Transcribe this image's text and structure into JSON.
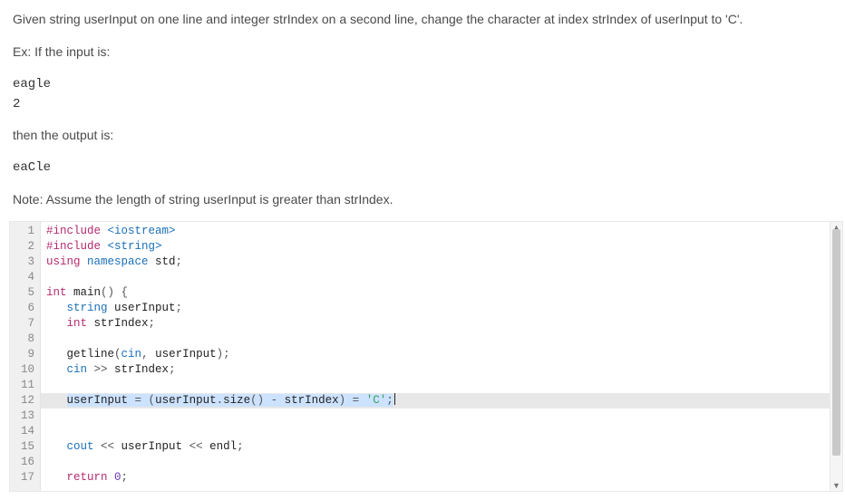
{
  "problem": {
    "statement": "Given string userInput on one line and integer strIndex on a second line, change the character at index strIndex of userInput to 'C'.",
    "example_intro": "Ex: If the input is:",
    "example_input": "eagle\n2",
    "output_intro": "then the output is:",
    "example_output": "eaCle",
    "note": "Note: Assume the length of string userInput is greater than strIndex."
  },
  "code": {
    "lines": [
      {
        "n": 1,
        "tokens": [
          {
            "t": "#include ",
            "c": "kw"
          },
          {
            "t": "<iostream>",
            "c": "type"
          }
        ]
      },
      {
        "n": 2,
        "tokens": [
          {
            "t": "#include ",
            "c": "kw"
          },
          {
            "t": "<string>",
            "c": "type"
          }
        ]
      },
      {
        "n": 3,
        "tokens": [
          {
            "t": "using ",
            "c": "kw"
          },
          {
            "t": "namespace ",
            "c": "type"
          },
          {
            "t": "std",
            "c": "ident"
          },
          {
            "t": ";",
            "c": "punct"
          }
        ]
      },
      {
        "n": 4,
        "tokens": []
      },
      {
        "n": 5,
        "tokens": [
          {
            "t": "int ",
            "c": "kw"
          },
          {
            "t": "main",
            "c": "ident"
          },
          {
            "t": "() {",
            "c": "punct"
          }
        ]
      },
      {
        "n": 6,
        "tokens": [
          {
            "t": "   ",
            "c": "ident"
          },
          {
            "t": "string ",
            "c": "type"
          },
          {
            "t": "userInput",
            "c": "ident"
          },
          {
            "t": ";",
            "c": "punct"
          }
        ]
      },
      {
        "n": 7,
        "tokens": [
          {
            "t": "   ",
            "c": "ident"
          },
          {
            "t": "int ",
            "c": "kw"
          },
          {
            "t": "strIndex",
            "c": "ident"
          },
          {
            "t": ";",
            "c": "punct"
          }
        ]
      },
      {
        "n": 8,
        "tokens": []
      },
      {
        "n": 9,
        "tokens": [
          {
            "t": "   ",
            "c": "ident"
          },
          {
            "t": "getline",
            "c": "ident"
          },
          {
            "t": "(",
            "c": "punct"
          },
          {
            "t": "cin",
            "c": "type"
          },
          {
            "t": ", ",
            "c": "punct"
          },
          {
            "t": "userInput",
            "c": "ident"
          },
          {
            "t": ");",
            "c": "punct"
          }
        ]
      },
      {
        "n": 10,
        "tokens": [
          {
            "t": "   ",
            "c": "ident"
          },
          {
            "t": "cin ",
            "c": "type"
          },
          {
            "t": ">> ",
            "c": "punct"
          },
          {
            "t": "strIndex",
            "c": "ident"
          },
          {
            "t": ";",
            "c": "punct"
          }
        ]
      },
      {
        "n": 11,
        "tokens": []
      },
      {
        "n": 12,
        "highlight": true,
        "selected": true,
        "tokens": [
          {
            "t": "   ",
            "c": "ident"
          },
          {
            "t": "userInput ",
            "c": "ident"
          },
          {
            "t": "= ",
            "c": "punct"
          },
          {
            "t": "(",
            "c": "punct"
          },
          {
            "t": "userInput",
            "c": "ident"
          },
          {
            "t": ".",
            "c": "punct"
          },
          {
            "t": "size",
            "c": "ident"
          },
          {
            "t": "() ",
            "c": "punct"
          },
          {
            "t": "- ",
            "c": "punct"
          },
          {
            "t": "strIndex",
            "c": "ident"
          },
          {
            "t": ") ",
            "c": "punct"
          },
          {
            "t": "= ",
            "c": "punct"
          },
          {
            "t": "'C'",
            "c": "str"
          },
          {
            "t": ";",
            "c": "punct"
          }
        ],
        "cursor_after": true
      },
      {
        "n": 13,
        "tokens": []
      },
      {
        "n": 14,
        "tokens": []
      },
      {
        "n": 15,
        "tokens": [
          {
            "t": "   ",
            "c": "ident"
          },
          {
            "t": "cout ",
            "c": "type"
          },
          {
            "t": "<< ",
            "c": "punct"
          },
          {
            "t": "userInput ",
            "c": "ident"
          },
          {
            "t": "<< ",
            "c": "punct"
          },
          {
            "t": "endl",
            "c": "ident"
          },
          {
            "t": ";",
            "c": "punct"
          }
        ]
      },
      {
        "n": 16,
        "tokens": []
      },
      {
        "n": 17,
        "tokens": [
          {
            "t": "   ",
            "c": "ident"
          },
          {
            "t": "return ",
            "c": "kw"
          },
          {
            "t": "0",
            "c": "num"
          },
          {
            "t": ";",
            "c": "punct"
          }
        ]
      }
    ]
  }
}
